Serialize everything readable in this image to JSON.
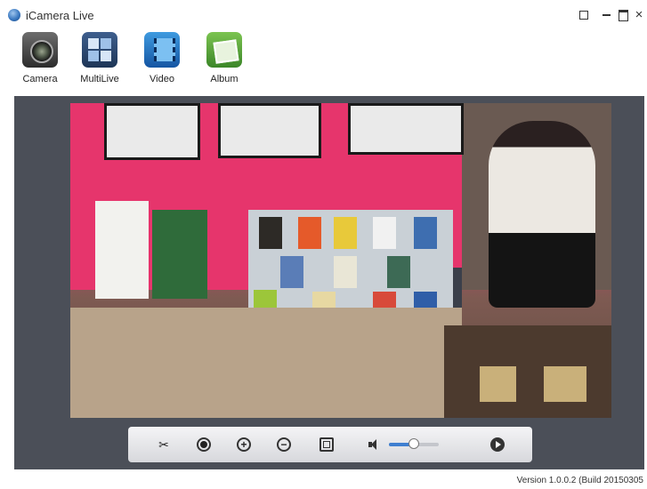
{
  "app": {
    "title": "iCamera Live"
  },
  "toolbar": {
    "items": [
      {
        "label": "Camera",
        "icon": "camera-icon"
      },
      {
        "label": "MultiLive",
        "icon": "multi-live-icon"
      },
      {
        "label": "Video",
        "icon": "video-icon"
      },
      {
        "label": "Album",
        "icon": "album-icon"
      }
    ]
  },
  "player": {
    "volume_level": 0.5,
    "controls": [
      "snapshot-icon",
      "record-icon",
      "zoom-in-icon",
      "zoom-out-icon",
      "fit-screen-icon",
      "volume-icon",
      "next-icon"
    ]
  },
  "status": {
    "version": "Version 1.0.0.2 (Build 20150305"
  },
  "colors": {
    "panel": "#4b4f58",
    "control_bar": "#e4e5e8",
    "accent": "#3f7fd0"
  }
}
